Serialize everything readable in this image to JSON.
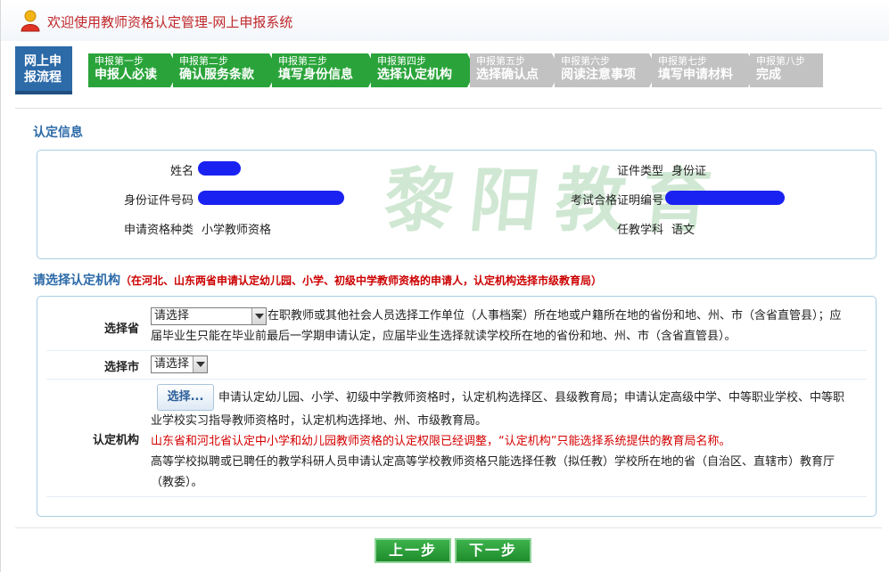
{
  "header": {
    "title": "欢迎使用教师资格认定管理-网上申报系统"
  },
  "steps": {
    "main_label_line1": "网上申",
    "main_label_line2": "报流程",
    "items": [
      {
        "num": "申报第一步",
        "name": "申报人必读",
        "state": "done"
      },
      {
        "num": "申报第二步",
        "name": "确认服务条款",
        "state": "done"
      },
      {
        "num": "申报第三步",
        "name": "填写身份信息",
        "state": "done"
      },
      {
        "num": "申报第四步",
        "name": "选择认定机构",
        "state": "done"
      },
      {
        "num": "申报第五步",
        "name": "选择确认点",
        "state": "todo"
      },
      {
        "num": "申报第六步",
        "name": "阅读注意事项",
        "state": "todo"
      },
      {
        "num": "申报第七步",
        "name": "填写申请材料",
        "state": "todo"
      },
      {
        "num": "申报第八步",
        "name": "完成",
        "state": "todo"
      }
    ]
  },
  "info": {
    "section_title": "认定信息",
    "name_label": "姓名",
    "id_label": "身份证件号码",
    "type_label": "申请资格种类",
    "type_value": "小学教师资格",
    "cert_type_label": "证件类型",
    "cert_type_value": "身份证",
    "exam_label": "考试合格证明编号",
    "subject_label": "任教学科",
    "subject_value": "语文",
    "watermark": "黎阳教育"
  },
  "org": {
    "section_title": "请选择认定机构",
    "section_note": "（在河北、山东两省申请认定幼儿园、小学、初级中学教师资格的申请人，认定机构选择市级教育局）",
    "province_label": "选择省",
    "province_select": "请选择",
    "province_desc_1": "在职教师或其他社会人员选择工作单位（人事档案）所在地或户籍所在地的省份和地、州、市（含省直管县）；应",
    "province_desc_2": "届毕业生只能在毕业前最后一学期申请认定，应届毕业生选择就读学校所在地的省份和地、州、市（含省直管县）。",
    "city_label": "选择市",
    "city_select": "请选择",
    "agency_label": "认定机构",
    "choose_button": "选择...",
    "agency_desc_1": "申请认定幼儿园、小学、初级中学教师资格时，认定机构选择区、县级教育局；申请认定高级中学、中等职业学校、中等职",
    "agency_desc_2": "业学校实习指导教师资格时，认定机构选择地、州、市级教育局。",
    "agency_desc_red": "山东省和河北省认定中小学和幼儿园教师资格的认定权限已经调整，“认定机构”只能选择系统提供的教育局名称。",
    "agency_desc_3": "高等学校拟聘或已聘任的教学科研人员申请认定高等学校教师资格只能选择任教（拟任教）学校所在地的省（自治区、直辖市）教育厅",
    "agency_desc_4": "（教委）。"
  },
  "nav": {
    "prev_label": "上一步",
    "next_label": "下一步"
  },
  "colors": {
    "brand_blue": "#2c6aa8",
    "step_done": "#2aa43a",
    "step_todo": "#c2c2c2",
    "title_red": "#c0282b",
    "redaction": "#1a22f2"
  }
}
